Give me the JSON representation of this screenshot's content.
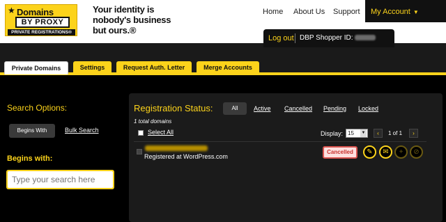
{
  "logo": {
    "line1": "Domains",
    "line2": "BY PROXY",
    "line3": "PRIVATE REGISTRATIONS®"
  },
  "tagline": {
    "line1": "Your identity is",
    "line2": "nobody's business",
    "line3": "but ours.®"
  },
  "nav": {
    "home": "Home",
    "about": "About Us",
    "support": "Support",
    "account": "My Account"
  },
  "account_bar": {
    "logout": "Log out",
    "shopper_label": "DBP Shopper ID:"
  },
  "tabs": [
    {
      "label": "Private Domains",
      "active": true
    },
    {
      "label": "Settings"
    },
    {
      "label": "Request Auth. Letter"
    },
    {
      "label": "Merge Accounts"
    }
  ],
  "sidebar": {
    "title": "Search Options:",
    "begins_with_btn": "Begins With",
    "bulk_search": "Bulk Search",
    "begins_with_label": "Begins with:",
    "search_placeholder": "Type your search here"
  },
  "main": {
    "title": "Registration Status:",
    "filters": [
      "All",
      "Active",
      "Cancelled",
      "Pending",
      "Locked"
    ],
    "total": "1 total domains",
    "select_all": "Select All",
    "display_label": "Display:",
    "display_value": "15",
    "page_info": "1 of 1",
    "row": {
      "registrar": "Registered at WordPress.com",
      "status": "Cancelled"
    }
  },
  "colors": {
    "accent": "#fcd31b",
    "background": "#000000",
    "panel": "#1b1b1b"
  }
}
